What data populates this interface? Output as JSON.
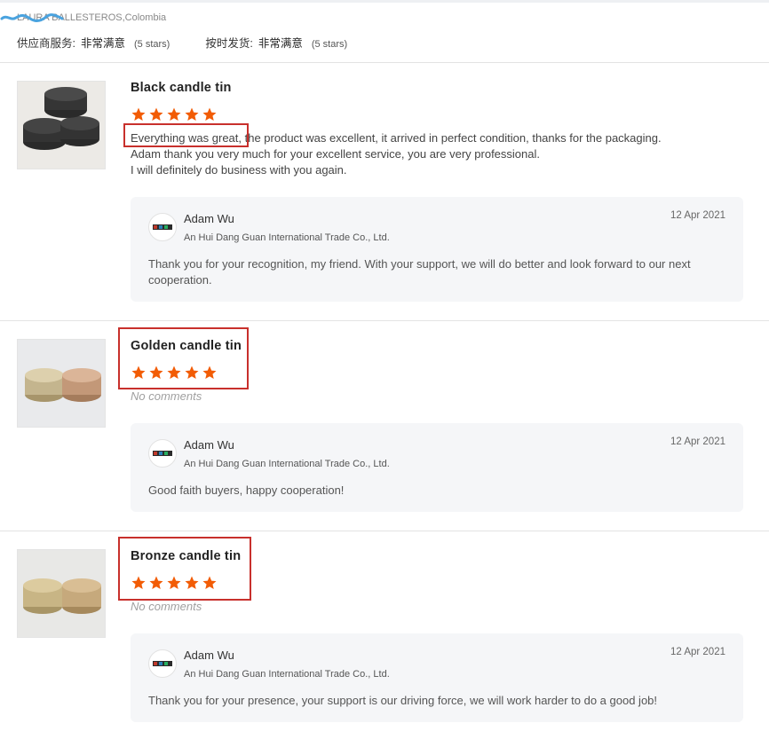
{
  "buyer": {
    "location": "LAURA BALLESTEROS,Colombia"
  },
  "ratings": [
    {
      "label": "供应商服务:",
      "value": "非常满意",
      "note": "(5 stars)"
    },
    {
      "label": "按时发货:",
      "value": "非常满意",
      "note": "(5 stars)"
    }
  ],
  "colors": {
    "star": "#f25c05",
    "highlight": "#c8302c",
    "reply_bg": "#f5f6f8"
  },
  "reviews": [
    {
      "product": "Black candle tin",
      "rating": 5,
      "comment_lines": [
        "Everything was great, the product was excellent, it arrived in perfect condition, thanks for the packaging.",
        "Adam thank you very much for your excellent service, you are very professional.",
        "I will definitely do business with you again."
      ],
      "reply": {
        "name": "Adam Wu",
        "company": "An Hui Dang Guan International Trade Co., Ltd.",
        "date": "12 Apr 2021",
        "text": "Thank you for your recognition, my friend. With your support, we will do better and look forward to our next cooperation."
      }
    },
    {
      "product": "Golden candle tin",
      "rating": 5,
      "no_comment": "No comments",
      "reply": {
        "name": "Adam Wu",
        "company": "An Hui Dang Guan International Trade Co., Ltd.",
        "date": "12 Apr 2021",
        "text": "Good faith buyers, happy cooperation!"
      }
    },
    {
      "product": "Bronze candle tin",
      "rating": 5,
      "no_comment": "No comments",
      "reply": {
        "name": "Adam Wu",
        "company": "An Hui Dang Guan International Trade Co., Ltd.",
        "date": "12 Apr 2021",
        "text": "Thank you for your presence, your support is our driving force, we will work harder to do a good job!"
      }
    }
  ]
}
